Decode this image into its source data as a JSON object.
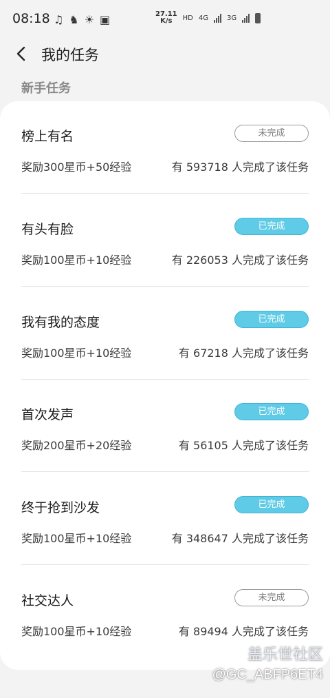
{
  "status_bar": {
    "time": "08:18",
    "net_speed_value": "27.11",
    "net_speed_unit": "K/s",
    "hd": "HD",
    "net1": "4G",
    "net2": "3G"
  },
  "header": {
    "title": "我的任务"
  },
  "section": {
    "title": "新手任务"
  },
  "colors": {
    "done_fill": "#60cbe6",
    "pending_border": "#9a9a9a"
  },
  "tasks": [
    {
      "name": "榜上有名",
      "status": "未完成",
      "reward": "奖励300星币+50经验",
      "count": "有 593718 人完成了该任务"
    },
    {
      "name": "有头有脸",
      "status": "已完成",
      "reward": "奖励100星币+10经验",
      "count": "有 226053 人完成了该任务"
    },
    {
      "name": "我有我的态度",
      "status": "已完成",
      "reward": "奖励100星币+10经验",
      "count": "有 67218 人完成了该任务"
    },
    {
      "name": "首次发声",
      "status": "已完成",
      "reward": "奖励200星币+20经验",
      "count": "有 56105 人完成了该任务"
    },
    {
      "name": "终于抢到沙发",
      "status": "已完成",
      "reward": "奖励100星币+10经验",
      "count": "有 348647 人完成了该任务"
    },
    {
      "name": "社交达人",
      "status": "未完成",
      "reward": "奖励100星币+10经验",
      "count": "有 89494 人完成了该任务"
    }
  ],
  "watermark": {
    "line1": "盖乐世社区",
    "line2": "@GC_ABFP6ET4"
  }
}
